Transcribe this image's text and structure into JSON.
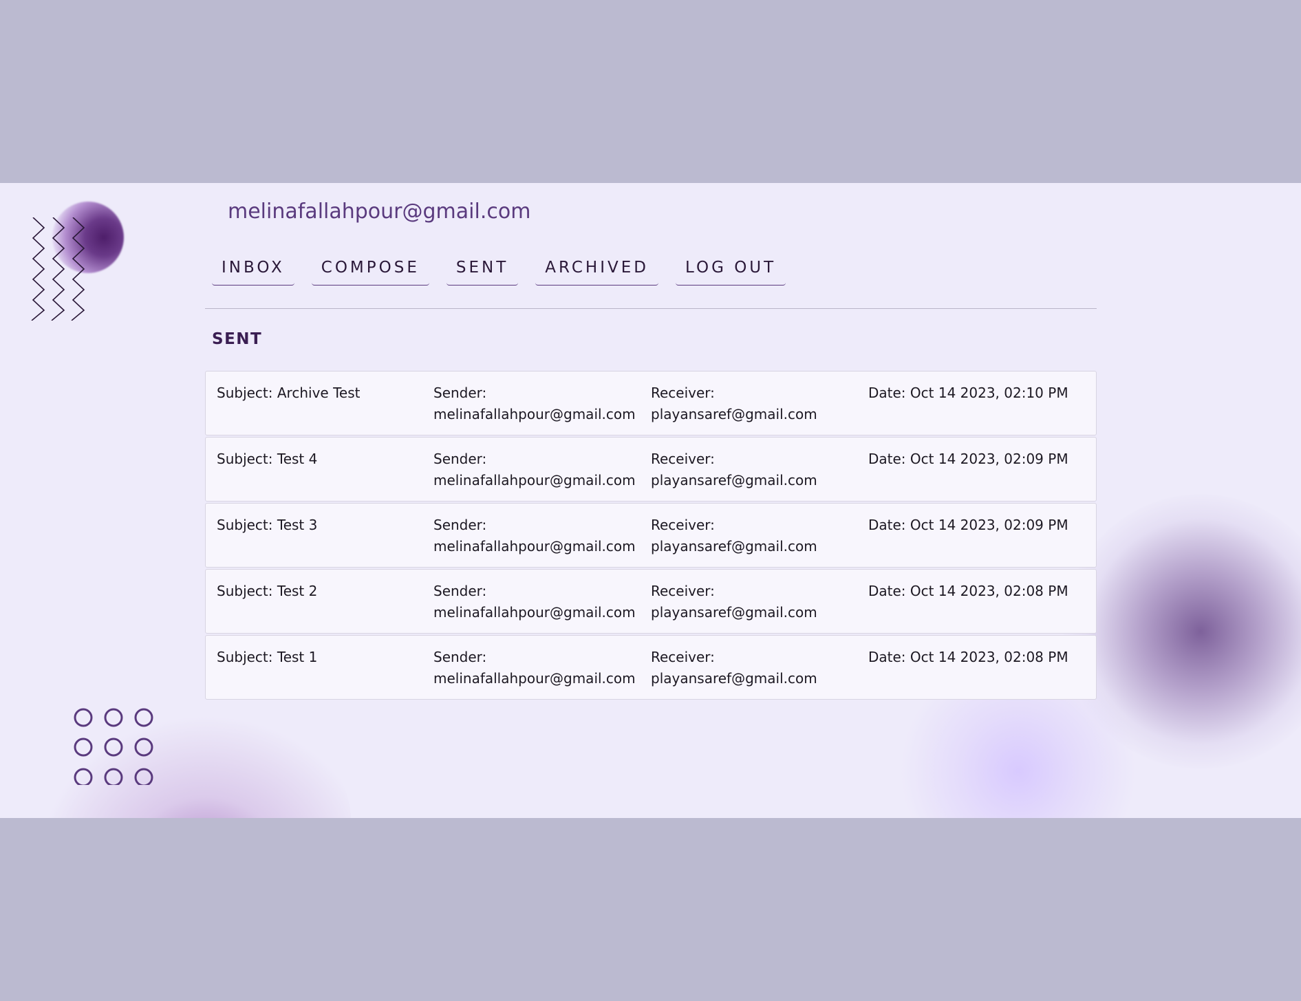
{
  "account": {
    "email": "melinafallahpour@gmail.com"
  },
  "nav": {
    "items": [
      {
        "label": "INBOX",
        "name": "nav-tab-inbox"
      },
      {
        "label": "COMPOSE",
        "name": "nav-tab-compose"
      },
      {
        "label": "SENT",
        "name": "nav-tab-sent"
      },
      {
        "label": "ARCHIVED",
        "name": "nav-tab-archived"
      },
      {
        "label": "LOG OUT",
        "name": "nav-tab-logout"
      }
    ]
  },
  "section": {
    "title": "SENT"
  },
  "labels": {
    "subject": "Subject:",
    "sender": "Sender:",
    "receiver": "Receiver:",
    "date": "Date:"
  },
  "emails": [
    {
      "subject": "Archive Test",
      "sender": "melinafallahpour@gmail.com",
      "receiver": "playansaref@gmail.com",
      "date": "Oct 14 2023, 02:10 PM"
    },
    {
      "subject": "Test 4",
      "sender": "melinafallahpour@gmail.com",
      "receiver": "playansaref@gmail.com",
      "date": "Oct 14 2023, 02:09 PM"
    },
    {
      "subject": "Test 3",
      "sender": "melinafallahpour@gmail.com",
      "receiver": "playansaref@gmail.com",
      "date": "Oct 14 2023, 02:09 PM"
    },
    {
      "subject": "Test 2",
      "sender": "melinafallahpour@gmail.com",
      "receiver": "playansaref@gmail.com",
      "date": "Oct 14 2023, 02:08 PM"
    },
    {
      "subject": "Test 1",
      "sender": "melinafallahpour@gmail.com",
      "receiver": "playansaref@gmail.com",
      "date": "Oct 14 2023, 02:08 PM"
    }
  ],
  "decor": {
    "orb": "gradient-orb-icon",
    "zigzag": "zigzag-lines-icon",
    "dots": "circle-grid-icon",
    "accent_color": "#5a3a7e"
  }
}
